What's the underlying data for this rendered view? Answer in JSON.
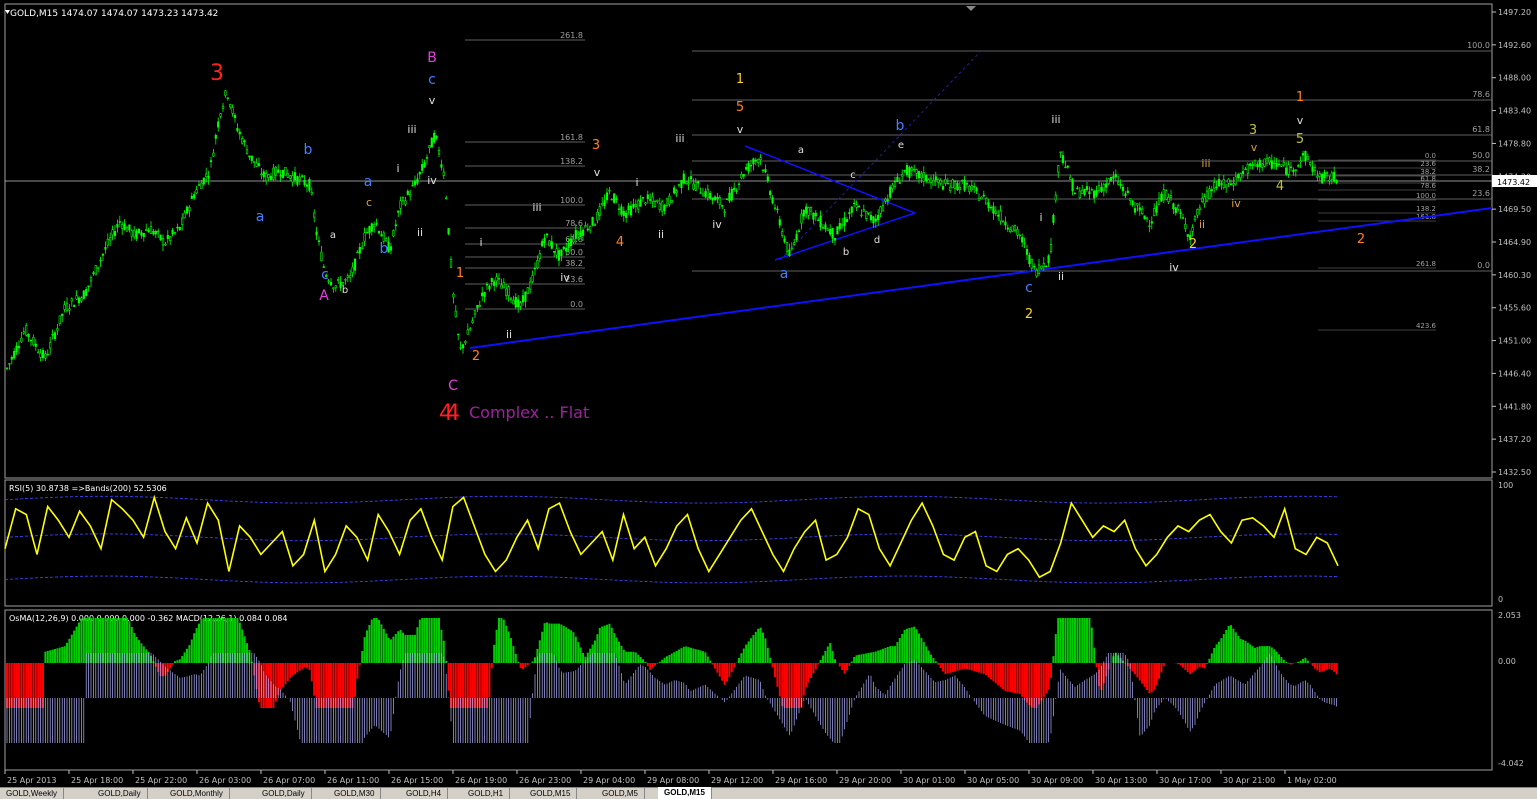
{
  "header": {
    "symbol": "GOLD,M15",
    "ohlc": "1474.07 1474.07 1473.23 1473.42",
    "current_price": "1473.42"
  },
  "colors": {
    "candle": "#00ff00",
    "trendline": "#1010ff",
    "rsi": "#ffff00",
    "bands": "#4040ff",
    "osma_up": "#00cc00",
    "osma_down": "#ff0000",
    "macd_hist": "#b0b0ff",
    "axis": "#c0c0c0",
    "grid": "#808080"
  },
  "chart_data": [
    {
      "type": "candlestick",
      "title": "GOLD,M15",
      "ylim": [
        1432.5,
        1498
      ],
      "y_ticks": [
        "1497.20",
        "1492.60",
        "1488.00",
        "1483.40",
        "1478.80",
        "1474.20",
        "1469.50",
        "1464.90",
        "1460.30",
        "1455.60",
        "1451.00",
        "1446.40",
        "1441.80",
        "1437.20",
        "1432.50"
      ],
      "x_ticks": [
        "25 Apr 2013",
        "25 Apr 18:00",
        "25 Apr 22:00",
        "26 Apr 03:00",
        "26 Apr 07:00",
        "26 Apr 11:00",
        "26 Apr 15:00",
        "26 Apr 19:00",
        "26 Apr 23:00",
        "29 Apr 04:00",
        "29 Apr 08:00",
        "29 Apr 12:00",
        "29 Apr 16:00",
        "29 Apr 20:00",
        "30 Apr 01:00",
        "30 Apr 05:00",
        "30 Apr 09:00",
        "30 Apr 13:00",
        "30 Apr 17:00",
        "30 Apr 21:00",
        "1 May 02:00"
      ],
      "price_path": [
        [
          0,
          1447
        ],
        [
          20,
          1453
        ],
        [
          40,
          1449
        ],
        [
          60,
          1456
        ],
        [
          80,
          1458
        ],
        [
          100,
          1464
        ],
        [
          115,
          1468
        ],
        [
          130,
          1466
        ],
        [
          145,
          1467
        ],
        [
          160,
          1465
        ],
        [
          175,
          1467
        ],
        [
          190,
          1472
        ],
        [
          205,
          1475
        ],
        [
          215,
          1483
        ],
        [
          222,
          1486
        ],
        [
          232,
          1481
        ],
        [
          245,
          1477
        ],
        [
          260,
          1474
        ],
        [
          275,
          1475
        ],
        [
          290,
          1474
        ],
        [
          305,
          1473
        ],
        [
          312,
          1466
        ],
        [
          320,
          1461
        ],
        [
          330,
          1459
        ],
        [
          345,
          1460
        ],
        [
          360,
          1466
        ],
        [
          370,
          1468
        ],
        [
          385,
          1464
        ],
        [
          395,
          1470
        ],
        [
          410,
          1473
        ],
        [
          420,
          1476
        ],
        [
          430,
          1480
        ],
        [
          440,
          1474
        ],
        [
          448,
          1458
        ],
        [
          455,
          1450
        ],
        [
          465,
          1453
        ],
        [
          478,
          1458
        ],
        [
          490,
          1460
        ],
        [
          505,
          1458
        ],
        [
          515,
          1456
        ],
        [
          528,
          1460
        ],
        [
          540,
          1466
        ],
        [
          555,
          1463
        ],
        [
          570,
          1466
        ],
        [
          590,
          1468
        ],
        [
          605,
          1472
        ],
        [
          620,
          1469
        ],
        [
          640,
          1471
        ],
        [
          660,
          1470
        ],
        [
          680,
          1474
        ],
        [
          700,
          1472
        ],
        [
          720,
          1470
        ],
        [
          740,
          1475
        ],
        [
          755,
          1477
        ],
        [
          770,
          1470
        ],
        [
          785,
          1463
        ],
        [
          800,
          1470
        ],
        [
          815,
          1468
        ],
        [
          830,
          1466
        ],
        [
          850,
          1470
        ],
        [
          870,
          1468
        ],
        [
          885,
          1472
        ],
        [
          900,
          1475
        ],
        [
          920,
          1474
        ],
        [
          940,
          1473
        ],
        [
          960,
          1473
        ],
        [
          980,
          1471
        ],
        [
          1000,
          1468
        ],
        [
          1015,
          1466
        ],
        [
          1030,
          1461
        ],
        [
          1045,
          1463
        ],
        [
          1055,
          1478
        ],
        [
          1070,
          1472
        ],
        [
          1090,
          1472
        ],
        [
          1110,
          1474
        ],
        [
          1130,
          1470
        ],
        [
          1145,
          1468
        ],
        [
          1160,
          1472
        ],
        [
          1175,
          1469
        ],
        [
          1185,
          1466
        ],
        [
          1195,
          1470
        ],
        [
          1210,
          1473
        ],
        [
          1225,
          1473
        ],
        [
          1240,
          1475
        ],
        [
          1255,
          1476
        ],
        [
          1270,
          1476
        ],
        [
          1285,
          1475
        ],
        [
          1300,
          1477
        ],
        [
          1315,
          1474
        ],
        [
          1330,
          1474
        ],
        [
          1338,
          1473.4
        ]
      ],
      "fib_levels_left": [
        "261.8",
        "161.8",
        "138.2",
        "100.0",
        "78.6",
        "61.8",
        "50.0",
        "38.2",
        "23.6",
        "0.0"
      ],
      "fib_levels_right": [
        "100.0",
        "78.6",
        "61.8",
        "50.0",
        "38.2",
        "23.6",
        "0.0"
      ],
      "fib_levels_right2": [
        "0.0",
        "23.6",
        "38.2",
        "61.8",
        "78.6",
        "100.0",
        "138.2",
        "161.8",
        "261.8",
        "423.6"
      ],
      "wave_labels": [
        {
          "t": "3",
          "c": "#ff2020",
          "s": 22
        },
        {
          "t": "B",
          "c": "#e040e0",
          "s": 14
        },
        {
          "t": "c",
          "c": "#4080ff",
          "s": 14
        },
        {
          "t": "v",
          "c": "#e0e0e0",
          "s": 11
        },
        {
          "t": "iii",
          "c": "#e0e0e0",
          "s": 11
        },
        {
          "t": "b",
          "c": "#4080ff",
          "s": 14
        },
        {
          "t": "a",
          "c": "#4080ff",
          "s": 14
        },
        {
          "t": "i",
          "c": "#e0e0e0",
          "s": 11
        },
        {
          "t": "c",
          "c": "#e0a040",
          "s": 11
        },
        {
          "t": "iv",
          "c": "#e0e0e0",
          "s": 11
        },
        {
          "t": "a",
          "c": "#4080ff",
          "s": 14
        },
        {
          "t": "a",
          "c": "#e0e0e0",
          "s": 10
        },
        {
          "t": "b",
          "c": "#e0e0e0",
          "s": 10
        },
        {
          "t": "ii",
          "c": "#e0e0e0",
          "s": 11
        },
        {
          "t": "b",
          "c": "#4080ff",
          "s": 14
        },
        {
          "t": "c",
          "c": "#4080ff",
          "s": 14
        },
        {
          "t": "A",
          "c": "#e040e0",
          "s": 14
        },
        {
          "t": "C",
          "c": "#e040e0",
          "s": 14
        },
        {
          "t": "4",
          "c": "#ff2020",
          "s": 22
        },
        {
          "t": "1",
          "c": "#ff8020",
          "s": 13
        },
        {
          "t": "2",
          "c": "#ff8020",
          "s": 13
        },
        {
          "t": "i",
          "c": "#e0e0e0",
          "s": 11
        },
        {
          "t": "ii",
          "c": "#e0e0e0",
          "s": 11
        },
        {
          "t": "iii",
          "c": "#e0e0e0",
          "s": 11
        },
        {
          "t": "iv",
          "c": "#e0e0e0",
          "s": 11
        },
        {
          "t": "3",
          "c": "#ff8020",
          "s": 13
        },
        {
          "t": "v",
          "c": "#e0e0e0",
          "s": 11
        },
        {
          "t": "4",
          "c": "#ff8020",
          "s": 13
        },
        {
          "t": "i",
          "c": "#e0e0e0",
          "s": 11
        },
        {
          "t": "ii",
          "c": "#e0e0e0",
          "s": 11
        },
        {
          "t": "iii",
          "c": "#e0e0e0",
          "s": 11
        },
        {
          "t": "1",
          "c": "#ffd020",
          "s": 13
        },
        {
          "t": "5",
          "c": "#ff8020",
          "s": 13
        },
        {
          "t": "v",
          "c": "#e0e0e0",
          "s": 11
        },
        {
          "t": "iv",
          "c": "#e0e0e0",
          "s": 11
        },
        {
          "t": "a",
          "c": "#4080ff",
          "s": 14
        },
        {
          "t": "a",
          "c": "#e0e0e0",
          "s": 10
        },
        {
          "t": "b",
          "c": "#e0e0e0",
          "s": 10
        },
        {
          "t": "c",
          "c": "#e0e0e0",
          "s": 10
        },
        {
          "t": "d",
          "c": "#e0e0e0",
          "s": 10
        },
        {
          "t": "e",
          "c": "#e0e0e0",
          "s": 10
        },
        {
          "t": "b",
          "c": "#4080ff",
          "s": 14
        },
        {
          "t": "iii",
          "c": "#e0e0e0",
          "s": 11
        },
        {
          "t": "i",
          "c": "#e0e0e0",
          "s": 11
        },
        {
          "t": "ii",
          "c": "#e0e0e0",
          "s": 11
        },
        {
          "t": "c",
          "c": "#4080ff",
          "s": 14
        },
        {
          "t": "2",
          "c": "#ffd020",
          "s": 13
        },
        {
          "t": "iii",
          "c": "#e0a040",
          "s": 11
        },
        {
          "t": "iv",
          "c": "#e0e0e0",
          "s": 11
        },
        {
          "t": "ii",
          "c": "#e0a040",
          "s": 11
        },
        {
          "t": "2",
          "c": "#ffd020",
          "s": 13
        },
        {
          "t": "iv",
          "c": "#e0a040",
          "s": 11
        },
        {
          "t": "3",
          "c": "#c0c040",
          "s": 13
        },
        {
          "t": "v",
          "c": "#e0a040",
          "s": 11
        },
        {
          "t": "4",
          "c": "#c0c040",
          "s": 13
        },
        {
          "t": "1",
          "c": "#ff8020",
          "s": 13
        },
        {
          "t": "v",
          "c": "#e0e0e0",
          "s": 11
        },
        {
          "t": "5",
          "c": "#c0c040",
          "s": 13
        },
        {
          "t": "2",
          "c": "#ff8020",
          "s": 13
        }
      ],
      "annotation": "Complex .. Flat",
      "annotation_number": "4"
    },
    {
      "type": "line",
      "title": "RSI(5) 30.8738  =>Bands(200) 52.5306",
      "ylim": [
        0,
        100
      ],
      "y_ticks": [
        "100",
        "0"
      ],
      "series": [
        {
          "name": "RSI(5)",
          "values": [
            45,
            80,
            75,
            40,
            82,
            70,
            55,
            78,
            65,
            45,
            88,
            80,
            70,
            55,
            90,
            60,
            45,
            72,
            50,
            85,
            70,
            25,
            65,
            55,
            40,
            50,
            60,
            30,
            40,
            70,
            25,
            40,
            65,
            55,
            35,
            75,
            60,
            40,
            70,
            80,
            55,
            35,
            82,
            90,
            65,
            40,
            25,
            35,
            55,
            70,
            45,
            80,
            85,
            60,
            40,
            50,
            60,
            35,
            75,
            45,
            55,
            30,
            45,
            65,
            75,
            45,
            25,
            40,
            55,
            70,
            80,
            60,
            40,
            25,
            45,
            60,
            70,
            35,
            40,
            55,
            80,
            75,
            45,
            30,
            50,
            70,
            85,
            65,
            40,
            35,
            55,
            60,
            30,
            25,
            40,
            45,
            35,
            20,
            25,
            50,
            85,
            70,
            55,
            65,
            60,
            70,
            45,
            30,
            40,
            55,
            65,
            60,
            70,
            75,
            60,
            50,
            70,
            72,
            65,
            55,
            80,
            45,
            40,
            55,
            50,
            30
          ]
        }
      ],
      "bands": {
        "upper_approx": 88,
        "mid_approx": 55,
        "lower_approx": 18
      }
    },
    {
      "type": "bar",
      "title": "OsMA(12,26,9) 0.000 0.000 0.000 -0.362  MACD(12,26,1) 0.084 0.084",
      "ylim": [
        -4.042,
        2.053
      ],
      "y_ticks": [
        "2.053",
        "0.00",
        "-4.042"
      ]
    }
  ],
  "tabs": [
    "GOLD,Weekly",
    "GOLD,Daily",
    "GOLD,Monthly",
    "GOLD,Daily",
    "GOLD,M30",
    "GOLD,H4",
    "GOLD,H1",
    "GOLD,M15",
    "GOLD,M5",
    "GOLD,M15"
  ]
}
